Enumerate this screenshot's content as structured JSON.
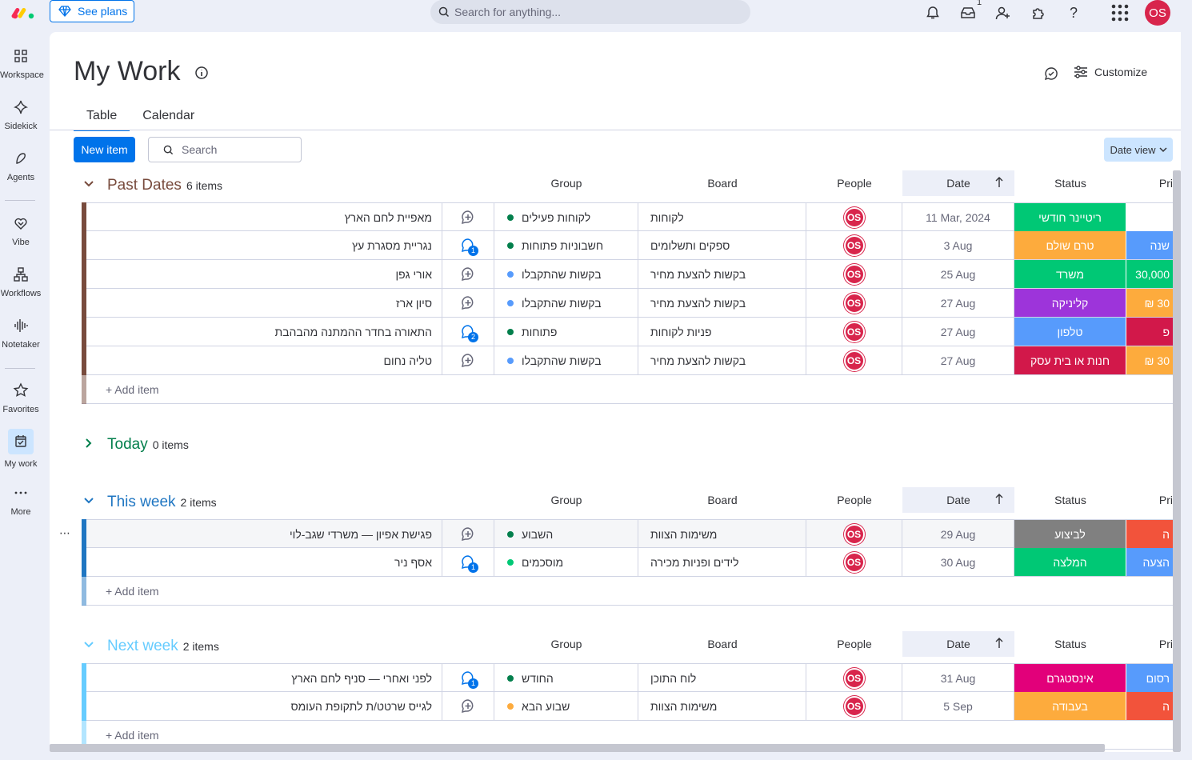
{
  "topbar": {
    "see_plans": "See plans",
    "search_placeholder": "Search for anything...",
    "inbox_badge": "1",
    "avatar_initials": "OS"
  },
  "nav": [
    {
      "label": "Workspace",
      "icon": "grid-icon"
    },
    {
      "label": "Sidekick",
      "icon": "sparkle-icon"
    },
    {
      "label": "Agents",
      "icon": "agents-icon"
    },
    {
      "label": "Vibe",
      "icon": "vibe-icon"
    },
    {
      "label": "Workflows",
      "icon": "workflows-icon"
    },
    {
      "label": "Notetaker",
      "icon": "waveform-icon"
    },
    {
      "label": "Favorites",
      "icon": "star-icon"
    },
    {
      "label": "My work",
      "icon": "calendar-check-icon"
    },
    {
      "label": "More",
      "icon": "more-dots-icon"
    }
  ],
  "page": {
    "title": "My Work",
    "customize": "Customize",
    "tabs": [
      "Table",
      "Calendar"
    ],
    "new_item": "New item",
    "search_placeholder": "Search",
    "date_view": "Date view"
  },
  "columns": {
    "group": "Group",
    "board": "Board",
    "people": "People",
    "date": "Date",
    "status": "Status",
    "priority": "Pri"
  },
  "add_item": "+ Add item",
  "groups": {
    "past": {
      "title": "Past Dates",
      "count": "6 items",
      "color": "#784b3d",
      "rows": [
        {
          "name": "מאפיית לחם הארץ",
          "updates": "",
          "group": "לקוחות פעילים",
          "dot": "#037f4c",
          "board": "לקוחות",
          "people": "OS",
          "date": "11 Mar, 2024",
          "status": "ריטיינר חודשי",
          "status_color": "#00c875",
          "pri": "",
          "pri_color": "#ffffff"
        },
        {
          "name": "נגריית מסגרת עץ",
          "updates": "1",
          "group": "חשבוניות פתוחות",
          "dot": "#037f4c",
          "board": "ספקים ותשלומים",
          "people": "OS",
          "date": "3 Aug",
          "status": "טרם שולם",
          "status_color": "#fdab3d",
          "pri": "שנה",
          "pri_color": "#579bfc"
        },
        {
          "name": "אורי גפן",
          "updates": "",
          "group": "בקשות שהתקבלו",
          "dot": "#579bfc",
          "board": "בקשות להצעת מחיר",
          "people": "OS",
          "date": "25 Aug",
          "status": "משרד",
          "status_color": "#00c875",
          "pri": "30,000",
          "pri_color": "#00c875"
        },
        {
          "name": "סיון ארז",
          "updates": "",
          "group": "בקשות שהתקבלו",
          "dot": "#579bfc",
          "board": "בקשות להצעת מחיר",
          "people": "OS",
          "date": "27 Aug",
          "status": "קליניקה",
          "status_color": "#9d34da",
          "pri": "₪ 30",
          "pri_color": "#fdab3d"
        },
        {
          "name": "התאורה בחדר ההמתנה מהבהבת",
          "updates": "2",
          "group": "פתוחות",
          "dot": "#037f4c",
          "board": "פניות לקוחות",
          "people": "OS",
          "date": "27 Aug",
          "status": "טלפון",
          "status_color": "#579bfc",
          "pri": "פ",
          "pri_color": "#d2184a"
        },
        {
          "name": "טליה נחום",
          "updates": "",
          "group": "בקשות שהתקבלו",
          "dot": "#579bfc",
          "board": "בקשות להצעת מחיר",
          "people": "OS",
          "date": "27 Aug",
          "status": "חנות או בית עסק",
          "status_color": "#d2184a",
          "pri": "₪ 30",
          "pri_color": "#fdab3d"
        }
      ]
    },
    "today": {
      "title": "Today",
      "count": "0 items",
      "color": "#037f4c"
    },
    "this_week": {
      "title": "This week",
      "count": "2 items",
      "color": "#1f76c2",
      "rows": [
        {
          "name": "פגישת אפיון — משרדי שגב-לוי",
          "updates": "",
          "group": "השבוע",
          "dot": "#037f4c",
          "board": "משימות הצוות",
          "people": "OS",
          "date": "29 Aug",
          "status": "לביצוע",
          "status_color": "#808080",
          "pri": "ה",
          "pri_color": "#f2533b"
        },
        {
          "name": "אסף ניר",
          "updates": "1",
          "group": "מוסכמים",
          "dot": "#00c875",
          "board": "לידים ופניות מכירה",
          "people": "OS",
          "date": "30 Aug",
          "status": "המלצה",
          "status_color": "#00c875",
          "pri": "הצעה",
          "pri_color": "#579bfc"
        }
      ]
    },
    "next_week": {
      "title": "Next week",
      "count": "2 items",
      "color": "#66ccff",
      "rows": [
        {
          "name": "לפני ואחרי — סניף לחם הארץ",
          "updates": "1",
          "group": "החודש",
          "dot": "#037f4c",
          "board": "לוח התוכן",
          "people": "OS",
          "date": "31 Aug",
          "status": "אינסטגרם",
          "status_color": "#e2007a",
          "pri": "רסום",
          "pri_color": "#579bfc"
        },
        {
          "name": "לגייס שרטט/ת לתקופת העומס",
          "updates": "",
          "group": "שבוע הבא",
          "dot": "#fdab3d",
          "board": "משימות הצוות",
          "people": "OS",
          "date": "5 Sep",
          "status": "בעבודה",
          "status_color": "#fdab3d",
          "pri": "ה",
          "pri_color": "#f2533b"
        }
      ]
    }
  }
}
